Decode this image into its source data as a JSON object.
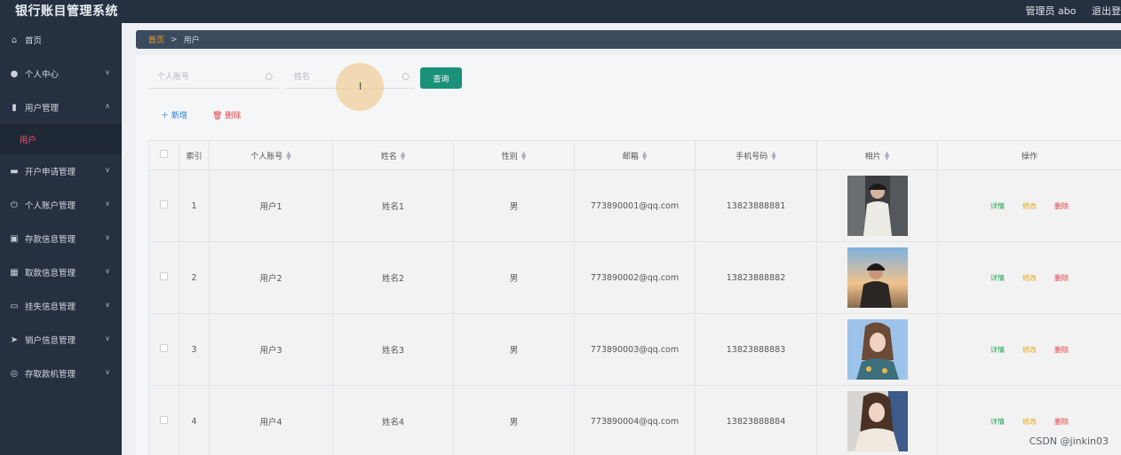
{
  "app": {
    "title": "银行账目管理系统",
    "admin_label": "管理员 abo",
    "logout_label": "退出登"
  },
  "sidebar": {
    "items": [
      {
        "label": "首页",
        "icon": "home-icon"
      },
      {
        "label": "个人中心",
        "icon": "user-icon"
      },
      {
        "label": "用户管理",
        "icon": "chart-icon"
      },
      {
        "label": "开户申请管理",
        "icon": "book-icon"
      },
      {
        "label": "个人账户管理",
        "icon": "power-icon"
      },
      {
        "label": "存款信息管理",
        "icon": "trend-icon"
      },
      {
        "label": "取款信息管理",
        "icon": "grid-icon"
      },
      {
        "label": "挂失信息管理",
        "icon": "message-icon"
      },
      {
        "label": "销户信息管理",
        "icon": "send-icon"
      },
      {
        "label": "存取款机管理",
        "icon": "compass-icon"
      }
    ],
    "active_sub": "用户"
  },
  "breadcrumb": {
    "home": "首页",
    "separator": ">",
    "current": "用户"
  },
  "search": {
    "account_placeholder": "个人账号",
    "name_placeholder": "姓名",
    "query_label": "查询"
  },
  "actions": {
    "add_label": "新增",
    "delete_label": "删除"
  },
  "table": {
    "headers": {
      "index": "索引",
      "account": "个人账号",
      "name": "姓名",
      "gender": "性别",
      "email": "邮箱",
      "phone": "手机号码",
      "photo": "相片",
      "ops": "操作"
    },
    "rows": [
      {
        "index": "1",
        "account": "用户1",
        "name": "姓名1",
        "gender": "男",
        "email": "773890001@qq.com",
        "phone": "13823888881"
      },
      {
        "index": "2",
        "account": "用户2",
        "name": "姓名2",
        "gender": "男",
        "email": "773890002@qq.com",
        "phone": "13823888882"
      },
      {
        "index": "3",
        "account": "用户3",
        "name": "姓名3",
        "gender": "男",
        "email": "773890003@qq.com",
        "phone": "13823888883"
      },
      {
        "index": "4",
        "account": "用户4",
        "name": "姓名4",
        "gender": "男",
        "email": "773890004@qq.com",
        "phone": "13823888884"
      }
    ],
    "ops": {
      "detail": "详情",
      "edit": "修改",
      "delete": "删除"
    }
  },
  "watermark": "CSDN @jinkin03",
  "colors": {
    "sidebar_bg": "#253141",
    "accent_green": "#1a9179",
    "active_red": "#ff4d6d",
    "breadcrumb_home": "#f0a030"
  }
}
